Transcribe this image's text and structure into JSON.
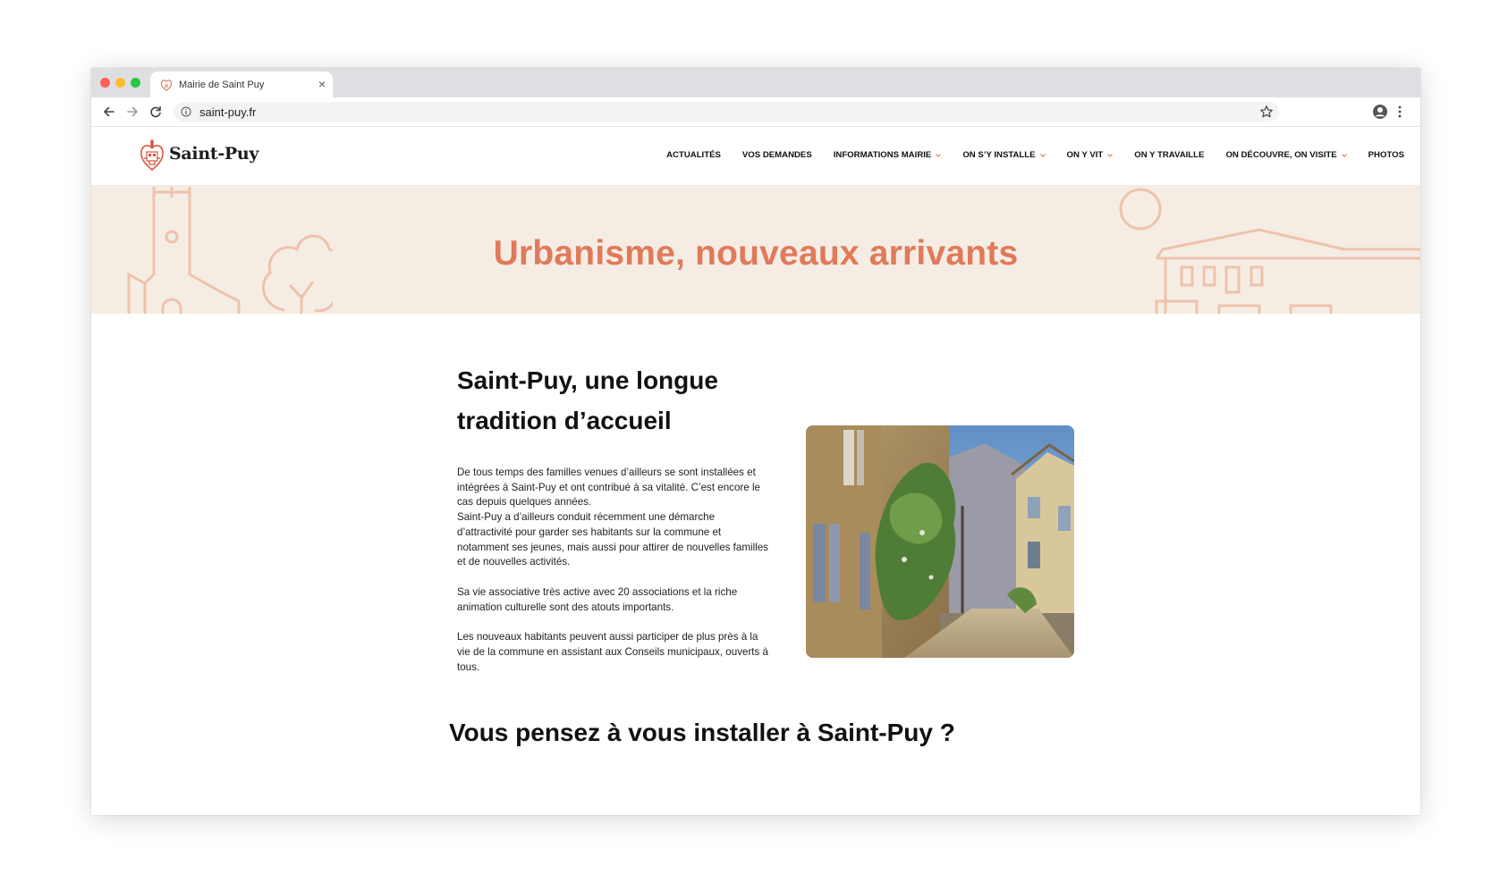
{
  "browser": {
    "tab_title": "Mairie de Saint Puy",
    "url": "saint-puy.fr"
  },
  "site": {
    "logo_text": "Saint-Puy",
    "nav": [
      {
        "label": "ACTUALITÉS",
        "has_dropdown": false
      },
      {
        "label": "VOS DEMANDES",
        "has_dropdown": false
      },
      {
        "label": "INFORMATIONS MAIRIE",
        "has_dropdown": true
      },
      {
        "label": "ON S’Y INSTALLE",
        "has_dropdown": true
      },
      {
        "label": "ON Y VIT",
        "has_dropdown": true
      },
      {
        "label": "ON Y TRAVAILLE",
        "has_dropdown": false
      },
      {
        "label": "ON DÉCOUVRE, ON VISITE",
        "has_dropdown": true
      },
      {
        "label": "PHOTOS",
        "has_dropdown": false
      }
    ]
  },
  "hero": {
    "title": "Urbanisme, nouveaux arrivants"
  },
  "intro": {
    "title": "Saint-Puy, une longue tradition d’accueil",
    "paragraphs": [
      "De tous temps des familles venues d’ailleurs se sont installées et intégrées à Saint-Puy et ont contribué à sa vitalité. C’est encore le cas depuis quelques années.\nSaint-Puy a d’ailleurs conduit récemment une démarche d’attractivité pour garder ses habitants sur la commune et notamment ses jeunes, mais aussi pour attirer de nouvelles familles et de nouvelles activités.",
      "Sa vie associative très active avec 20 associations et la riche animation culturelle sont des atouts importants.",
      "Les nouveaux habitants peuvent aussi participer de plus près à la vie de la commune en assistant aux Conseils municipaux, ouverts à tous."
    ]
  },
  "section2": {
    "title": "Vous pensez à vous installer à Saint-Puy ?"
  },
  "colors": {
    "accent": "#e07a5a",
    "hero_bg": "#f5ede4",
    "deco_stroke": "#eec2ad"
  },
  "icons": [
    "info-icon",
    "star-icon",
    "profile-icon",
    "kebab-menu-icon",
    "back-arrow-icon",
    "forward-arrow-icon",
    "reload-icon",
    "close-icon",
    "chevron-down-icon"
  ]
}
